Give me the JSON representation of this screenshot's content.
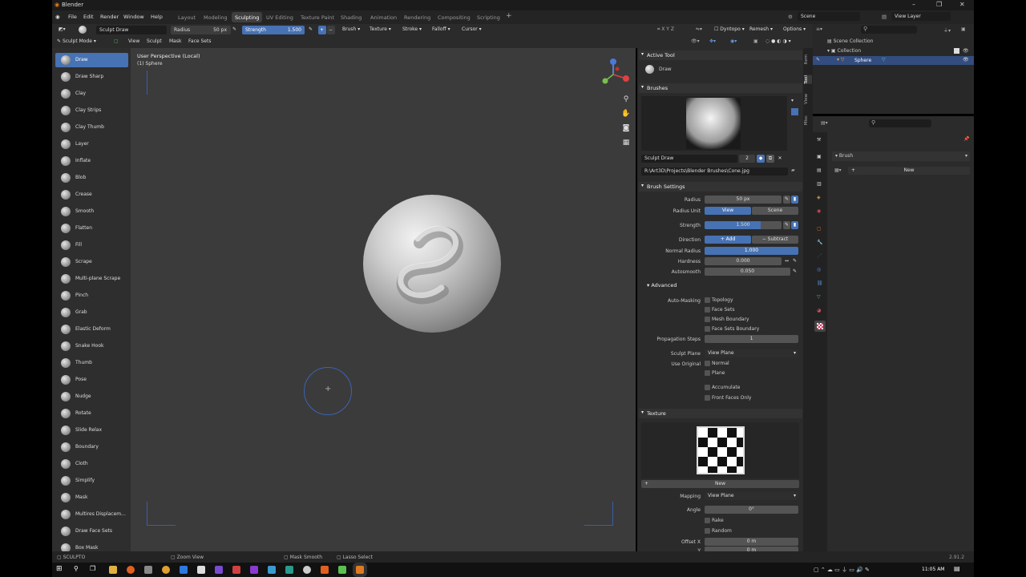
{
  "window": {
    "title": "Blender"
  },
  "menu": [
    "File",
    "Edit",
    "Render",
    "Window",
    "Help"
  ],
  "workspaces": [
    "Layout",
    "Modeling",
    "Sculpting",
    "UV Editing",
    "Texture Paint",
    "Shading",
    "Animation",
    "Rendering",
    "Compositing",
    "Scripting"
  ],
  "topright": {
    "scene": "Scene",
    "view_layer": "View Layer"
  },
  "header": {
    "brush_name": "Sculpt Draw",
    "radius_label": "Radius",
    "radius_value": "50 px",
    "strength_label": "Strength",
    "strength_value": "1.500",
    "menus": [
      "Brush",
      "Texture",
      "Stroke",
      "Falloff",
      "Cursor"
    ],
    "right_menus": [
      "Dyntopo",
      "Remesh",
      "Options"
    ],
    "mode": "Sculpt Mode",
    "view_menus": [
      "View",
      "Sculpt",
      "Mask",
      "Face Sets"
    ]
  },
  "tools": [
    "Draw",
    "Draw Sharp",
    "Clay",
    "Clay Strips",
    "Clay Thumb",
    "Layer",
    "Inflate",
    "Blob",
    "Crease",
    "Smooth",
    "Flatten",
    "Fill",
    "Scrape",
    "Multi-plane Scrape",
    "Pinch",
    "Grab",
    "Elastic Deform",
    "Snake Hook",
    "Thumb",
    "Pose",
    "Nudge",
    "Rotate",
    "Slide Relax",
    "Boundary",
    "Cloth",
    "Simplify",
    "Mask",
    "Multires Displacem...",
    "Draw Face Sets",
    "Box Mask"
  ],
  "viewport": {
    "perspective": "User Perspective (Local)",
    "object": "(1) Sphere"
  },
  "npanel": {
    "active_tool_title": "Active Tool",
    "active_tool": "Draw",
    "brushes_title": "Brushes",
    "brush_name": "Sculpt Draw",
    "brush_users": "2",
    "brush_path": "R:\\Art3D\\Projects\\Blender Brushes\\Cone.jpg",
    "brush_settings_title": "Brush Settings",
    "radius_label": "Radius",
    "radius_value": "50 px",
    "radius_unit_label": "Radius Unit",
    "radius_unit_view": "View",
    "radius_unit_scene": "Scene",
    "strength_label": "Strength",
    "strength_value": "1.500",
    "direction_label": "Direction",
    "direction_add": "Add",
    "direction_subtract": "Subtract",
    "normal_radius_label": "Normal Radius",
    "normal_radius_value": "1.000",
    "hardness_label": "Hardness",
    "hardness_value": "0.000",
    "autosmooth_label": "Autosmooth",
    "autosmooth_value": "0.050",
    "advanced_title": "Advanced",
    "automasking_label": "Auto-Masking",
    "automasking": [
      "Topology",
      "Face Sets",
      "Mesh Boundary",
      "Face Sets Boundary"
    ],
    "propagation_label": "Propagation Steps",
    "propagation_value": "1",
    "sculpt_plane_label": "Sculpt Plane",
    "sculpt_plane_value": "View Plane",
    "use_original_label": "Use Original",
    "use_original": [
      "Normal",
      "Plane"
    ],
    "accumulate": "Accumulate",
    "front_faces": "Front Faces Only",
    "texture_title": "Texture",
    "texture_new": "New",
    "mapping_label": "Mapping",
    "mapping_value": "View Plane",
    "angle_label": "Angle",
    "angle_value": "0°",
    "rake": "Rake",
    "random": "Random",
    "offset_x_label": "Offset X",
    "offset_x_value": "0 m",
    "offset_y_label": "Y",
    "offset_y_value": "0 m"
  },
  "sidetabs": [
    "Item",
    "Tool",
    "View",
    "Misc"
  ],
  "outliner": {
    "scene_collection": "Scene Collection",
    "collection": "Collection",
    "object": "Sphere"
  },
  "properties": {
    "brush_label": "Brush",
    "new_label": "New"
  },
  "statusbar": {
    "mode": "SCULPTO",
    "zoom": "Zoom View",
    "mask": "Mask Smooth",
    "lasso": "Lasso Select",
    "version": "2.91.2"
  },
  "taskbar": {
    "time": "11:05 AM"
  },
  "colors": {
    "accent": "#4772b3",
    "bg": "#2b2b2b",
    "viewport": "#3b3b3b"
  }
}
